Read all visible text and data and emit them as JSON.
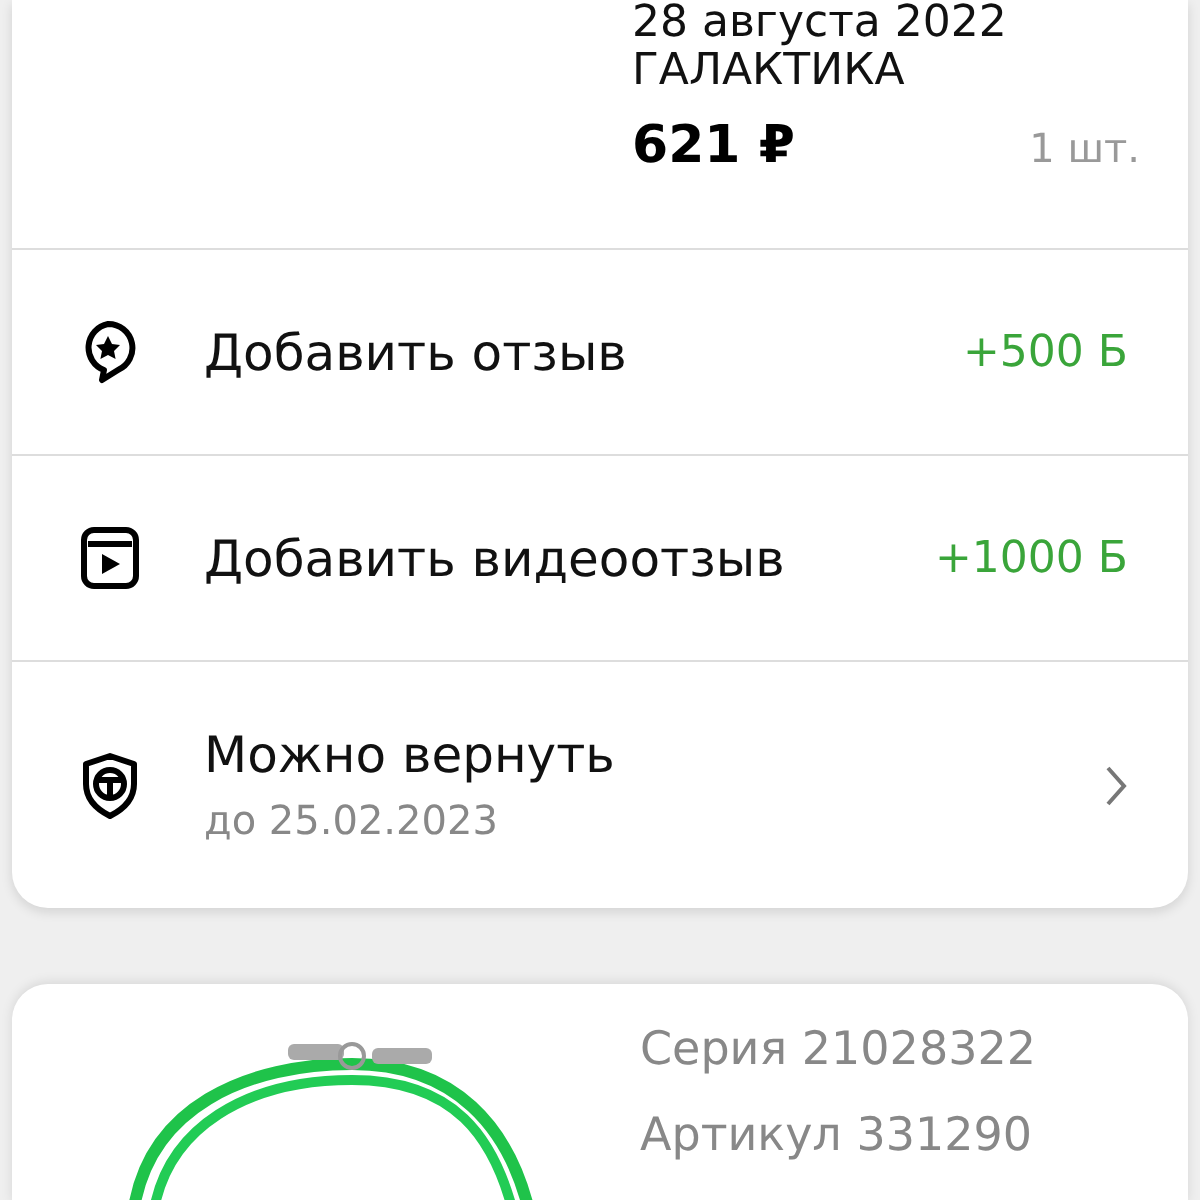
{
  "order_item": {
    "date": "28 августа 2022",
    "brand": "ГАЛАКТИКА",
    "price": "621 ₽",
    "quantity": "1 шт."
  },
  "actions": [
    {
      "kind": "review",
      "label": "Добавить отзыв",
      "bonus": "+500 Б"
    },
    {
      "kind": "video",
      "label": "Добавить видеоотзыв",
      "bonus": "+1000 Б"
    },
    {
      "kind": "return",
      "label": "Можно вернуть",
      "note": "до 25.02.2023"
    }
  ],
  "next_item": {
    "series": "Серия 21028322",
    "article": "Артикул 331290"
  }
}
